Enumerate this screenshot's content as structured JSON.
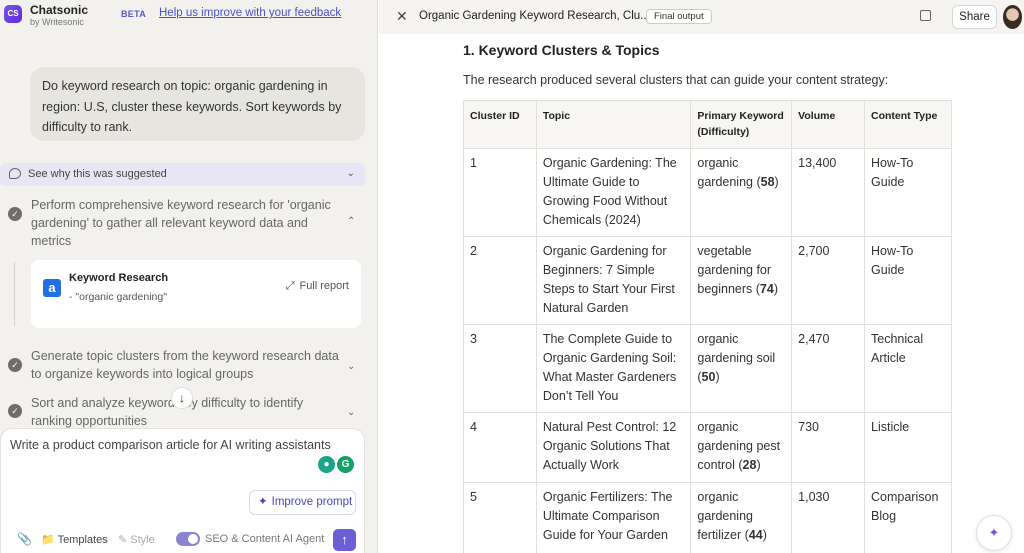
{
  "app": {
    "logo_text": "CS",
    "name": "Chatsonic",
    "by": "by Writesonic",
    "beta": "BETA",
    "feedback_link": "Help us improve with your feedback"
  },
  "chat": {
    "user_message": "Do keyword research on topic: organic gardening in region: U.S, cluster these keywords. Sort keywords by difficulty to rank.",
    "suggested": "See why this was suggested",
    "steps": [
      {
        "text": "Perform comprehensive keyword research for 'organic gardening' to gather all relevant keyword data and metrics"
      },
      {
        "text": "Generate topic clusters from the keyword research data to organize keywords into logical groups"
      },
      {
        "text": "Sort and analyze keywords by difficulty to identify ranking opportunities"
      }
    ],
    "tool_card": {
      "icon": "a",
      "title": "Keyword Research",
      "detail": "- \"organic gardening\"",
      "action": "Full report"
    }
  },
  "composer": {
    "placeholder": "Write a product comparison article for AI writing assistants",
    "improve_prompt": "Improve prompt",
    "templates": "Templates",
    "style": "Style",
    "agent_toggle": "SEO & Content AI Agent"
  },
  "output": {
    "title": "Organic Gardening Keyword Research, Clu...",
    "badge": "Final output",
    "share": "Share",
    "heading": "1. Keyword Clusters & Topics",
    "intro": "The research produced several clusters that can guide your content strategy:",
    "table": {
      "headers": [
        "Cluster ID",
        "Topic",
        "Primary Keyword (Difficulty)",
        "Volume",
        "Content Type"
      ],
      "rows": [
        [
          "1",
          "Organic Gardening: The Ultimate Guide to Growing Food Without Chemicals (2024)",
          "organic gardening",
          "58",
          "13,400",
          "How-To Guide"
        ],
        [
          "2",
          "Organic Gardening for Beginners: 7 Simple Steps to Start Your First Natural Garden",
          "vegetable gardening for beginners",
          "74",
          "2,700",
          "How-To Guide"
        ],
        [
          "3",
          "The Complete Guide to Organic Gardening Soil: What Master Gardeners Don’t Tell You",
          "organic gardening soil",
          "50",
          "2,470",
          "Technical Article"
        ],
        [
          "4",
          "Natural Pest Control: 12 Organic Solutions That Actually Work",
          "organic gardening pest control",
          "28",
          "730",
          "Listicle"
        ],
        [
          "5",
          "Organic Fertilizers: The Ultimate Comparison Guide for Your Garden",
          "organic gardening fertilizer",
          "44",
          "1,030",
          "Comparison Blog"
        ]
      ]
    }
  }
}
